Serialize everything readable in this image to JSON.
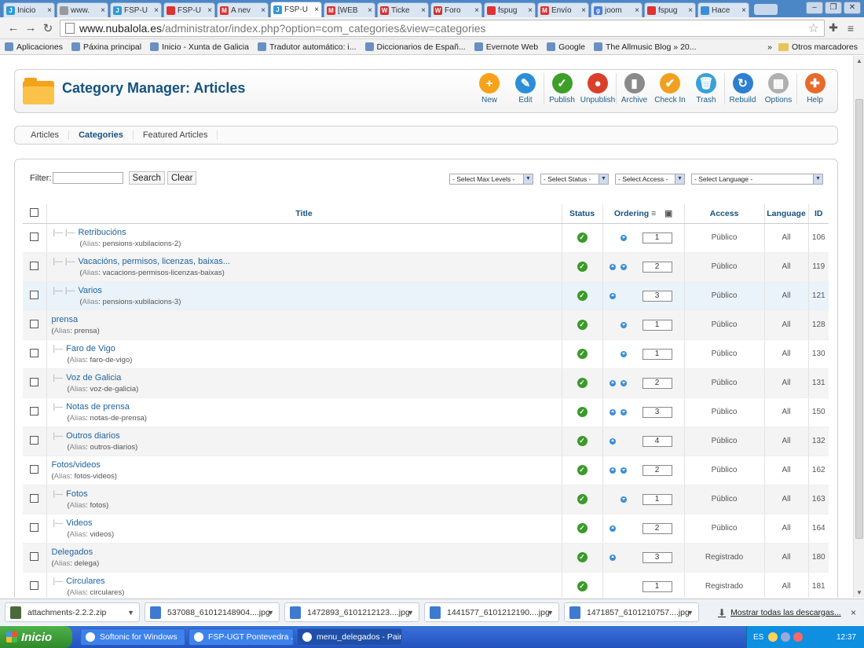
{
  "browser": {
    "tabs": [
      {
        "label": "Inicio",
        "fav": "#2e9bd6",
        "g": "J",
        "active": false
      },
      {
        "label": "www.",
        "fav": "#999999",
        "g": "",
        "active": false
      },
      {
        "label": "FSP-U",
        "fav": "#2e9bd6",
        "g": "J",
        "active": false
      },
      {
        "label": "FSP-U",
        "fav": "#d33",
        "g": "",
        "active": false
      },
      {
        "label": "A nev",
        "fav": "#d33",
        "g": "M",
        "active": false
      },
      {
        "label": "FSP-U",
        "fav": "#2e9bd6",
        "g": "J",
        "active": true
      },
      {
        "label": "[WEB",
        "fav": "#d33",
        "g": "M",
        "active": false
      },
      {
        "label": "Ticke",
        "fav": "#c33",
        "g": "W",
        "active": false
      },
      {
        "label": "Foro",
        "fav": "#c33",
        "g": "W",
        "active": false
      },
      {
        "label": "fspug",
        "fav": "#d33",
        "g": "",
        "active": false
      },
      {
        "label": "Envío",
        "fav": "#d33",
        "g": "M",
        "active": false
      },
      {
        "label": "joom",
        "fav": "#4a7dd6",
        "g": "g",
        "active": false
      },
      {
        "label": "fspug",
        "fav": "#d33",
        "g": "",
        "active": false
      },
      {
        "label": "Hace",
        "fav": "#3b8ed6",
        "g": "",
        "active": false
      }
    ],
    "url_host": "www.nubalola.es",
    "url_rest": "/administrator/index.php?option=com_categories&view=categories",
    "bookmarks": [
      "Aplicaciones",
      "Páxina principal",
      "Inicio - Xunta de Galicia",
      "Tradutor automático: i...",
      "Diccionarios de Españ...",
      "Evernote Web",
      "Google",
      "The Allmusic Blog » 20..."
    ],
    "bookmarks_more": "»",
    "other_bookmarks": "Otros marcadores"
  },
  "header": {
    "title": "Category Manager: Articles",
    "toolbar": [
      {
        "label": "New",
        "color": "#f7a21b",
        "glyph": "+"
      },
      {
        "label": "Edit",
        "color": "#2c8ed6",
        "glyph": "✎"
      },
      {
        "label": "Publish",
        "color": "#3e9e2a",
        "glyph": "✓"
      },
      {
        "label": "Unpublish",
        "color": "#d9402b",
        "glyph": "●"
      },
      {
        "label": "Archive",
        "color": "#8a8a8a",
        "glyph": "▮"
      },
      {
        "label": "Check In",
        "color": "#f0a020",
        "glyph": "✔"
      },
      {
        "label": "Trash",
        "color": "#3aa0d8",
        "glyph": "🗑"
      },
      {
        "label": "Rebuild",
        "color": "#2d7fd0",
        "glyph": "↻"
      },
      {
        "label": "Options",
        "color": "#b0b0b0",
        "glyph": "▦"
      },
      {
        "label": "Help",
        "color": "#e76b2c",
        "glyph": "✚"
      }
    ]
  },
  "submenu": [
    {
      "label": "Articles",
      "active": false
    },
    {
      "label": "Categories",
      "active": true
    },
    {
      "label": "Featured Articles",
      "active": false
    }
  ],
  "filter": {
    "label": "Filter:",
    "search": "Search",
    "clear": "Clear",
    "max_levels": "- Select Max Levels -",
    "status": "- Select Status -",
    "access": "- Select Access -",
    "language": "- Select Language -"
  },
  "table": {
    "headers": {
      "title": "Title",
      "status": "Status",
      "ordering": "Ordering",
      "access": "Access",
      "language": "Language",
      "id": "ID"
    },
    "alias_label": "Alias",
    "rows": [
      {
        "title": "Retribucións",
        "alias": "pensions-xubilacions-2",
        "level": 3,
        "up": false,
        "down": true,
        "order": "1",
        "access": "Público",
        "language": "All",
        "id": "106"
      },
      {
        "title": "Vacacións, permisos, licenzas, baixas...",
        "alias": "vacacions-permisos-licenzas-baixas",
        "level": 3,
        "up": true,
        "down": true,
        "order": "2",
        "access": "Público",
        "language": "All",
        "id": "119"
      },
      {
        "title": "Varios",
        "alias": "pensions-xubilacions-3",
        "level": 3,
        "up": true,
        "down": false,
        "order": "3",
        "access": "Público",
        "language": "All",
        "id": "121",
        "hl": true
      },
      {
        "title": "prensa",
        "alias": "prensa",
        "level": 1,
        "up": false,
        "down": true,
        "order": "1",
        "access": "Público",
        "language": "All",
        "id": "128"
      },
      {
        "title": "Faro de Vigo",
        "alias": "faro-de-vigo",
        "level": 2,
        "up": false,
        "down": true,
        "order": "1",
        "access": "Público",
        "language": "All",
        "id": "130"
      },
      {
        "title": "Voz de Galicia",
        "alias": "voz-de-galicia",
        "level": 2,
        "up": true,
        "down": true,
        "order": "2",
        "access": "Público",
        "language": "All",
        "id": "131"
      },
      {
        "title": "Notas de prensa",
        "alias": "notas-de-prensa",
        "level": 2,
        "up": true,
        "down": true,
        "order": "3",
        "access": "Público",
        "language": "All",
        "id": "150"
      },
      {
        "title": "Outros diarios",
        "alias": "outros-diarios",
        "level": 2,
        "up": true,
        "down": false,
        "order": "4",
        "access": "Público",
        "language": "All",
        "id": "132"
      },
      {
        "title": "Fotos/videos",
        "alias": "fotos-videos",
        "level": 1,
        "up": true,
        "down": true,
        "order": "2",
        "access": "Público",
        "language": "All",
        "id": "162"
      },
      {
        "title": "Fotos",
        "alias": "fotos",
        "level": 2,
        "up": false,
        "down": true,
        "order": "1",
        "access": "Público",
        "language": "All",
        "id": "163"
      },
      {
        "title": "Videos",
        "alias": "videos",
        "level": 2,
        "up": true,
        "down": false,
        "order": "2",
        "access": "Público",
        "language": "All",
        "id": "164"
      },
      {
        "title": "Delegados",
        "alias": "delega",
        "level": 1,
        "up": true,
        "down": false,
        "order": "3",
        "access": "Registrado",
        "language": "All",
        "id": "180"
      },
      {
        "title": "Circulares",
        "alias": "circulares",
        "level": 2,
        "up": false,
        "down": false,
        "order": "1",
        "access": "Registrado",
        "language": "All",
        "id": "181"
      }
    ]
  },
  "downloads": {
    "items": [
      "attachments-2.2.2.zip",
      "537088_61012148904....jpg",
      "1472893_6101212123....jpg",
      "1441577_6101212190....jpg",
      "1471857_6101210757....jpg"
    ],
    "show_all": "Mostrar todas las descargas...",
    "close": "×"
  },
  "taskbar": {
    "start": "Inicio",
    "tasks": [
      "Softonic for Windows",
      "FSP-UGT Pontevedra ...",
      "menu_delegados - Paint"
    ],
    "lang": "ES",
    "clock": "12:37"
  }
}
